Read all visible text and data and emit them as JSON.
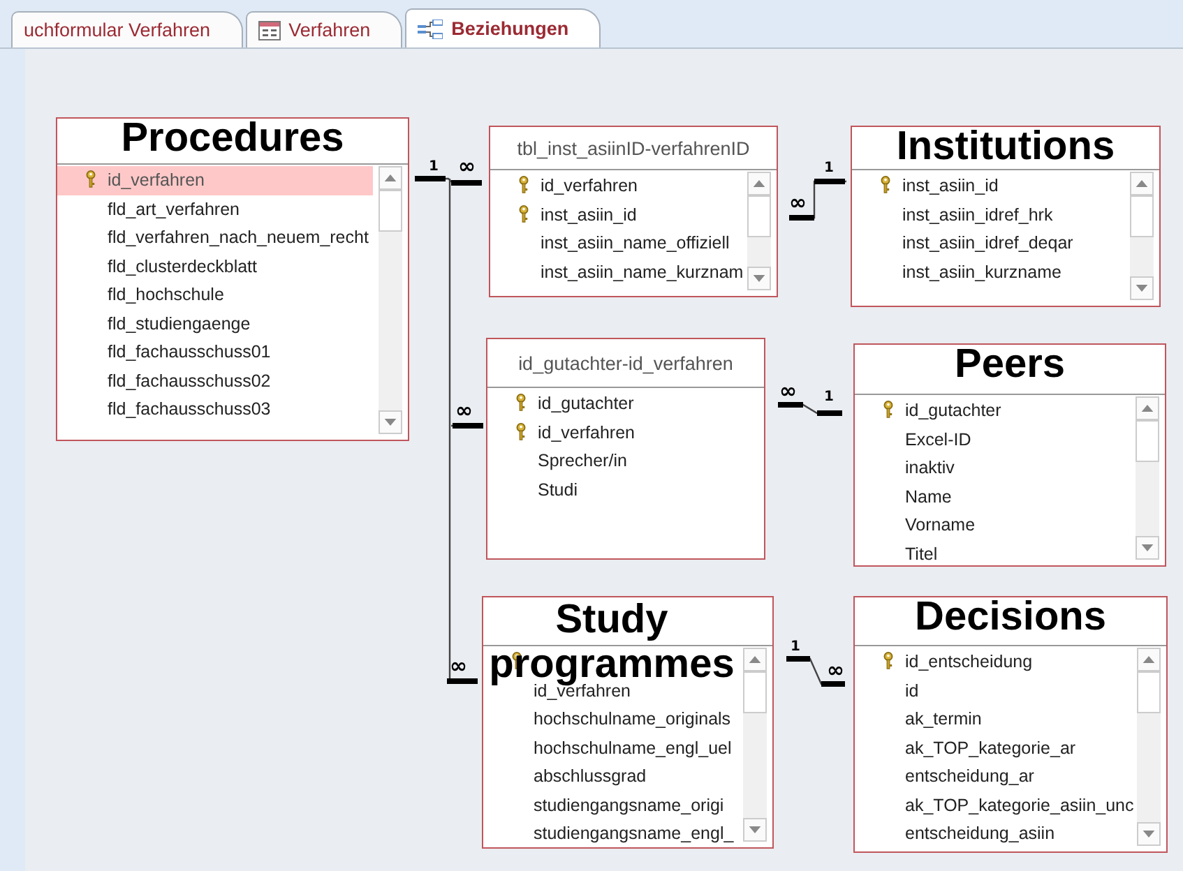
{
  "tabs": [
    {
      "label": "uchformular Verfahren",
      "selected": false
    },
    {
      "label": "Verfahren",
      "selected": false
    },
    {
      "label": "Beziehungen",
      "selected": true
    }
  ],
  "tables": [
    {
      "overlay": "Procedures",
      "scrollbar": true,
      "rows": [
        {
          "text": "id_verfahren",
          "key": true,
          "selected": true
        },
        {
          "text": "fld_art_verfahren",
          "key": false,
          "selected": false
        },
        {
          "text": "fld_verfahren_nach_neuem_recht",
          "key": false,
          "selected": false
        },
        {
          "text": "fld_clusterdeckblatt",
          "key": false,
          "selected": false
        },
        {
          "text": "fld_hochschule",
          "key": false,
          "selected": false
        },
        {
          "text": "fld_studiengaenge",
          "key": false,
          "selected": false
        },
        {
          "text": "fld_fachausschuss01",
          "key": false,
          "selected": false
        },
        {
          "text": "fld_fachausschuss02",
          "key": false,
          "selected": false
        },
        {
          "text": "fld_fachausschuss03",
          "key": false,
          "selected": false
        }
      ]
    },
    {
      "title": "tbl_inst_asiinID-verfahrenID",
      "scrollbar": true,
      "rows": [
        {
          "text": "id_verfahren",
          "key": true,
          "selected": false
        },
        {
          "text": "inst_asiin_id",
          "key": true,
          "selected": false
        },
        {
          "text": "inst_asiin_name_offiziell",
          "key": false,
          "selected": false
        },
        {
          "text": "inst_asiin_name_kurznam",
          "key": false,
          "selected": false
        }
      ]
    },
    {
      "overlay": "Institutions",
      "scrollbar": true,
      "rows": [
        {
          "text": "inst_asiin_id",
          "key": true,
          "selected": false
        },
        {
          "text": "inst_asiin_idref_hrk",
          "key": false,
          "selected": false
        },
        {
          "text": "inst_asiin_idref_deqar",
          "key": false,
          "selected": false
        },
        {
          "text": "inst_asiin_kurzname",
          "key": false,
          "selected": false
        }
      ]
    },
    {
      "title": "id_gutachter-id_verfahren",
      "scrollbar": false,
      "rows": [
        {
          "text": "id_gutachter",
          "key": true,
          "selected": false
        },
        {
          "text": "id_verfahren",
          "key": true,
          "selected": false
        },
        {
          "text": "Sprecher/in",
          "key": false,
          "selected": false
        },
        {
          "text": "Studi",
          "key": false,
          "selected": false
        }
      ]
    },
    {
      "overlay": "Peers",
      "scrollbar": true,
      "rows": [
        {
          "text": "id_gutachter",
          "key": true,
          "selected": false
        },
        {
          "text": "Excel-ID",
          "key": false,
          "selected": false
        },
        {
          "text": "inaktiv",
          "key": false,
          "selected": false
        },
        {
          "text": "Name",
          "key": false,
          "selected": false
        },
        {
          "text": "Vorname",
          "key": false,
          "selected": false
        },
        {
          "text": "Titel",
          "key": false,
          "selected": false
        }
      ]
    },
    {
      "overlay": "Study programmes",
      "scrollbar": true,
      "rows": [
        {
          "key": true,
          "selected": false
        },
        {
          "text": "id_verfahren",
          "key": false,
          "selected": false
        },
        {
          "text": "hochschulname_originals",
          "key": false,
          "selected": false
        },
        {
          "text": "hochschulname_engl_uel",
          "key": false,
          "selected": false
        },
        {
          "text": "abschlussgrad",
          "key": false,
          "selected": false
        },
        {
          "text": "studiengangsname_origi",
          "key": false,
          "selected": false
        },
        {
          "text": "studiengangsname_engl_",
          "key": false,
          "selected": false
        }
      ]
    },
    {
      "overlay": "Decisions",
      "scrollbar": true,
      "rows": [
        {
          "text": "id_entscheidung",
          "key": true,
          "selected": false
        },
        {
          "text": "id",
          "key": false,
          "selected": false
        },
        {
          "text": "ak_termin",
          "key": false,
          "selected": false
        },
        {
          "text": "ak_TOP_kategorie_ar",
          "key": false,
          "selected": false
        },
        {
          "text": "entscheidung_ar",
          "key": false,
          "selected": false
        },
        {
          "text": "ak_TOP_kategorie_asiin_unc",
          "key": false,
          "selected": false
        },
        {
          "text": "entscheidung_asiin",
          "key": false,
          "selected": false
        }
      ]
    }
  ],
  "relationships": [
    {
      "one": "1",
      "many": [
        "∞",
        "∞",
        "∞"
      ]
    },
    {
      "one": "1",
      "many": [
        "∞"
      ]
    },
    {
      "one": "1",
      "many": [
        "∞"
      ]
    },
    {
      "one": "1",
      "many": [
        "∞"
      ]
    }
  ]
}
